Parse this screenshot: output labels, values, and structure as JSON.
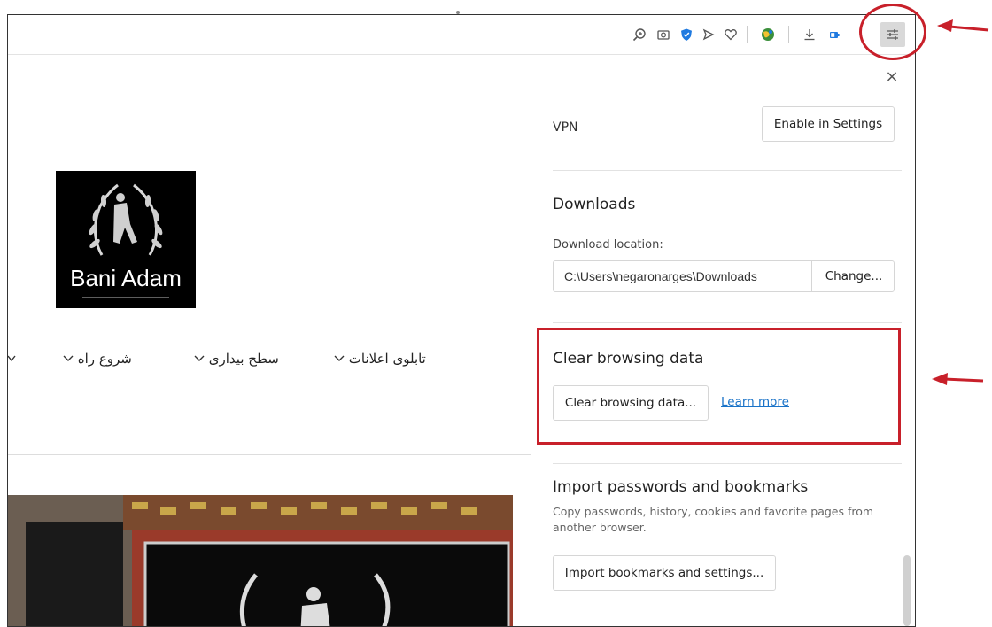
{
  "toolbar": {
    "icons": [
      "zoom-icon",
      "camera-icon",
      "vpn-shield-icon",
      "send-icon",
      "heart-icon",
      "extension-globe-icon",
      "download-icon",
      "battery-icon",
      "easy-setup-icon"
    ]
  },
  "page": {
    "logo_text": "Bani Adam",
    "nav": [
      {
        "label": "تابلوی اعلانات"
      },
      {
        "label": "سطح بیداری"
      },
      {
        "label": "شروع راه"
      }
    ]
  },
  "panel": {
    "close_label": "×",
    "vpn": {
      "label": "VPN",
      "button": "Enable in Settings"
    },
    "downloads": {
      "title": "Downloads",
      "location_label": "Download location:",
      "location_value": "C:\\Users\\negaronarges\\Downloads",
      "change_button": "Change..."
    },
    "clear": {
      "title": "Clear browsing data",
      "button": "Clear browsing data...",
      "link": "Learn more"
    },
    "import": {
      "title": "Import passwords and bookmarks",
      "description": "Copy passwords, history, cookies and favorite pages from another browser.",
      "button": "Import bookmarks and settings..."
    }
  },
  "colors": {
    "annotation": "#c8202a",
    "link": "#1a73c8",
    "vpn_blue": "#1f7ae0"
  }
}
